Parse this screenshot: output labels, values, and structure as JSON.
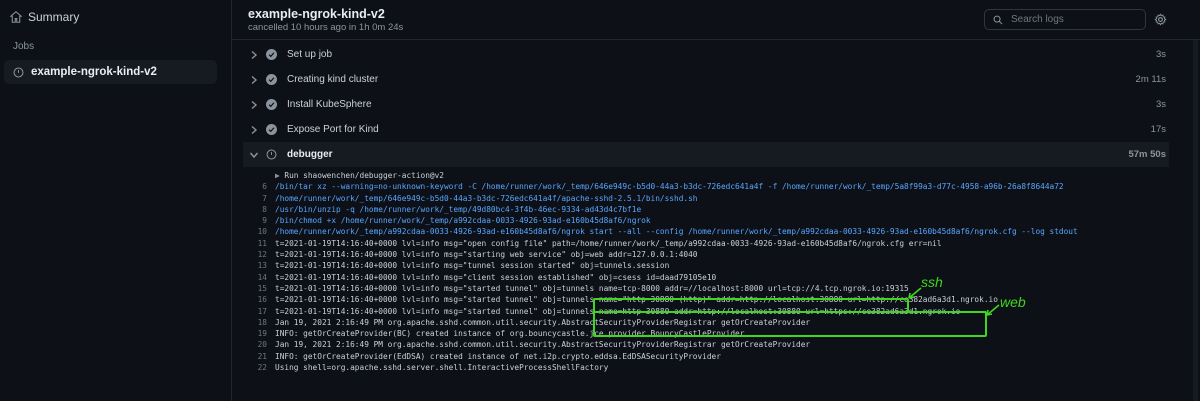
{
  "sidebar": {
    "summary_label": "Summary",
    "jobs_label": "Jobs",
    "job_name": "example-ngrok-kind-v2"
  },
  "header": {
    "title": "example-ngrok-kind-v2",
    "status": "cancelled 10 hours ago in 1h 0m 24s",
    "search_placeholder": "Search logs"
  },
  "steps": [
    {
      "name": "Set up job",
      "duration": "3s"
    },
    {
      "name": "Creating kind cluster",
      "duration": "2m 11s"
    },
    {
      "name": "Install KubeSphere",
      "duration": "3s"
    },
    {
      "name": "Expose Port for Kind",
      "duration": "17s"
    },
    {
      "name": "debugger",
      "duration": "57m 50s"
    }
  ],
  "log": {
    "run_line": "Run shaowenchen/debugger-action@v2",
    "lines": [
      {
        "n": "6",
        "t": "/bin/tar xz --warning=no-unknown-keyword -C /home/runner/work/_temp/646e949c-b5d0-44a3-b3dc-726edc641a4f -f /home/runner/work/_temp/5a8f99a3-d77c-4958-a96b-26a8f8644a72"
      },
      {
        "n": "7",
        "t": "/home/runner/work/_temp/646e949c-b5d0-44a3-b3dc-726edc641a4f/apache-sshd-2.5.1/bin/sshd.sh"
      },
      {
        "n": "8",
        "t": "/usr/bin/unzip -q /home/runner/work/_temp/49d80bc4-3f4b-46ec-9334-ad43d4c7bf1e"
      },
      {
        "n": "9",
        "t": "/bin/chmod +x /home/runner/work/_temp/a992cdaa-0033-4926-93ad-e160b45d8af6/ngrok"
      },
      {
        "n": "10",
        "t": "/home/runner/work/_temp/a992cdaa-0033-4926-93ad-e160b45d8af6/ngrok start --all --config /home/runner/work/_temp/a992cdaa-0033-4926-93ad-e160b45d8af6/ngrok.cfg --log stdout"
      },
      {
        "n": "11",
        "t": "t=2021-01-19T14:16:40+0000 lvl=info msg=\"open config file\" path=/home/runner/work/_temp/a992cdaa-0033-4926-93ad-e160b45d8af6/ngrok.cfg err=nil"
      },
      {
        "n": "12",
        "t": "t=2021-01-19T14:16:40+0000 lvl=info msg=\"starting web service\" obj=web addr=127.0.0.1:4040"
      },
      {
        "n": "13",
        "t": "t=2021-01-19T14:16:40+0000 lvl=info msg=\"tunnel session started\" obj=tunnels.session"
      },
      {
        "n": "14",
        "t": "t=2021-01-19T14:16:40+0000 lvl=info msg=\"client session established\" obj=csess id=daad79105e10"
      },
      {
        "n": "15",
        "t": "t=2021-01-19T14:16:40+0000 lvl=info msg=\"started tunnel\" obj=tunnels name=tcp-8000 addr=//localhost:8000 url=tcp://4.tcp.ngrok.io:19315"
      },
      {
        "n": "16",
        "t": "t=2021-01-19T14:16:40+0000 lvl=info msg=\"started tunnel\" obj=tunnels name=\"http-30880 (http)\" addr=http://localhost:30880 url=http://ce382ad6a3d1.ngrok.io"
      },
      {
        "n": "17",
        "t": "t=2021-01-19T14:16:40+0000 lvl=info msg=\"started tunnel\" obj=tunnels name=http-30880 addr=http://localhost:30880 url=https://ce382ad6a3d1.ngrok.io"
      },
      {
        "n": "18",
        "t": "Jan 19, 2021 2:16:49 PM org.apache.sshd.common.util.security.AbstractSecurityProviderRegistrar getOrCreateProvider"
      },
      {
        "n": "19",
        "t": "INFO: getOrCreateProvider(BC) created instance of org.bouncycastle.jce.provider.BouncyCastleProvider"
      },
      {
        "n": "20",
        "t": "Jan 19, 2021 2:16:49 PM org.apache.sshd.common.util.security.AbstractSecurityProviderRegistrar getOrCreateProvider"
      },
      {
        "n": "21",
        "t": "INFO: getOrCreateProvider(EdDSA) created instance of net.i2p.crypto.eddsa.EdDSASecurityProvider"
      },
      {
        "n": "22",
        "t": "Using shell=org.apache.sshd.server.shell.InteractiveProcessShellFactory"
      }
    ]
  },
  "annotations": {
    "ssh_label": "ssh",
    "web_label": "web"
  },
  "colors": {
    "annotation": "#3fd61e",
    "link": "#58a6ff",
    "success": "#8b949e"
  }
}
